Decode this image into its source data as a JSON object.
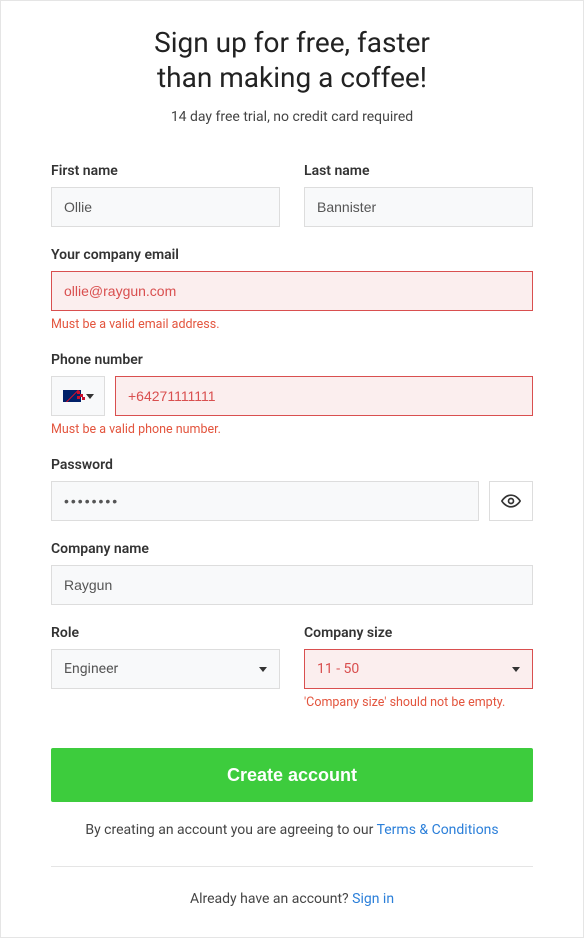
{
  "heading_line1": "Sign up for free, faster",
  "heading_line2": "than making a coffee!",
  "subheading": "14 day free trial, no credit card required",
  "first_name": {
    "label": "First name",
    "value": "Ollie"
  },
  "last_name": {
    "label": "Last name",
    "value": "Bannister"
  },
  "email": {
    "label": "Your company email",
    "value": "ollie@raygun.com",
    "error": "Must be a valid email address."
  },
  "phone": {
    "label": "Phone number",
    "value": "+64271111111",
    "error": "Must be a valid phone number.",
    "country": "NZ"
  },
  "password": {
    "label": "Password",
    "value": "••••••••"
  },
  "company_name": {
    "label": "Company name",
    "value": "Raygun"
  },
  "role": {
    "label": "Role",
    "value": "Engineer"
  },
  "company_size": {
    "label": "Company size",
    "value": "11 - 50",
    "error": "'Company size' should not be empty."
  },
  "submit_label": "Create account",
  "terms_prefix": "By creating an account you are agreeing to our ",
  "terms_link": "Terms & Conditions",
  "signin_prefix": "Already have an account? ",
  "signin_link": "Sign in"
}
